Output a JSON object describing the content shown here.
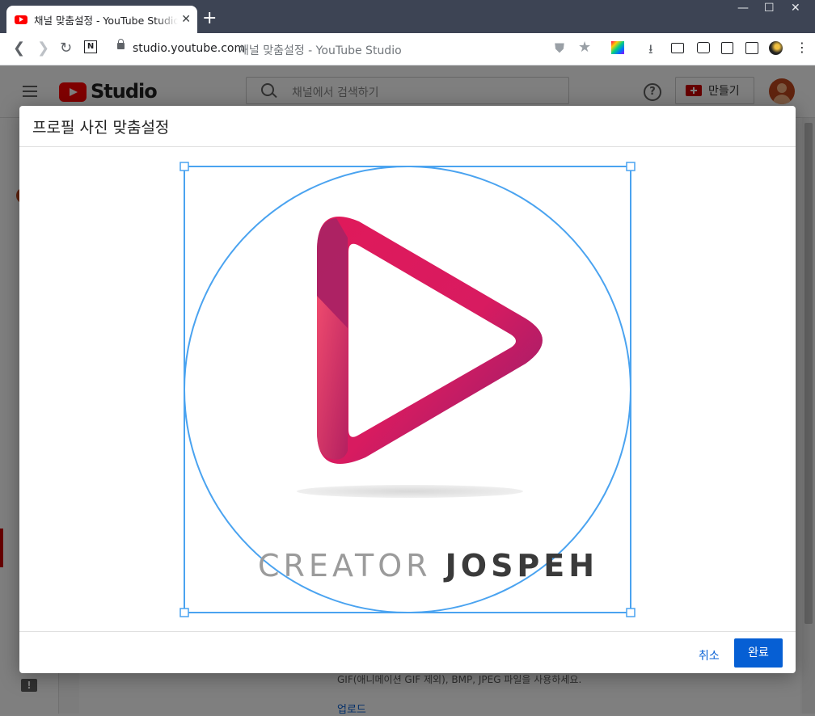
{
  "browser": {
    "tab_title": "채널 맞춤설정 - YouTube Studio",
    "tab_close": "✕",
    "new_tab": "+",
    "window_controls": {
      "minimize": "—",
      "maximize": "☐",
      "close": "✕"
    },
    "address": {
      "host": "studio.youtube.com",
      "page_title": "채널 맞춤설정 - YouTube Studio"
    },
    "toolbar_icons": [
      "back-icon",
      "forward-icon",
      "reload-icon",
      "notion-icon",
      "shield-icon",
      "star-icon",
      "color-extension-icon",
      "download-icon",
      "video-icon",
      "camera-icon",
      "reader-icon",
      "sidebar-icon",
      "profile-icon",
      "menu-icon"
    ]
  },
  "studio": {
    "logo_text": "Studio",
    "search_placeholder": "채널에서 검색하기",
    "help_icon_glyph": "?",
    "create_label": "만들기",
    "feedback_glyph": "!",
    "bottom_note": "GIF(애니메이션 GIF 제외), BMP, JPEG 파일을 사용하세요.",
    "bottom_link": "업로드"
  },
  "dialog": {
    "title": "프로필 사진 맞춤설정",
    "image_text": {
      "word1": "CREATOR",
      "word2": "JOSPEH"
    },
    "cancel_label": "취소",
    "done_label": "완료",
    "colors": {
      "accent": "#065fd4",
      "crop_frame": "#4aa3f0",
      "logo_pink": "#e0195a",
      "logo_purple": "#9c1f6a"
    }
  }
}
